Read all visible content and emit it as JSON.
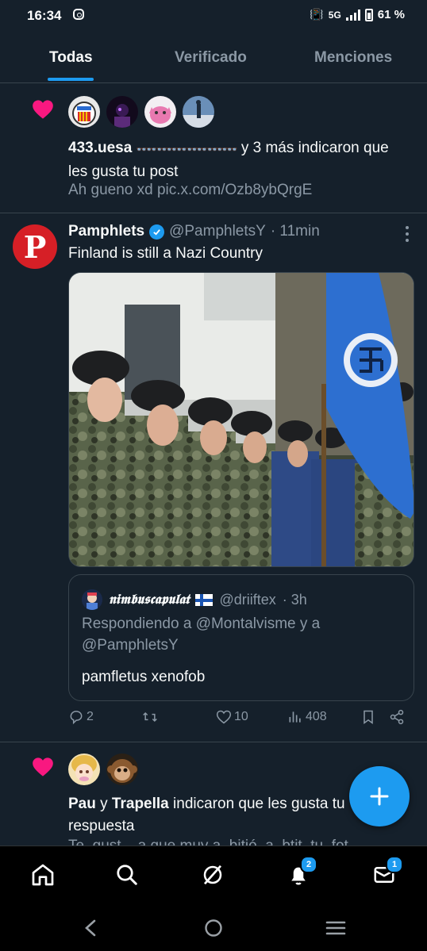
{
  "status_bar": {
    "time": "16:34",
    "network": "5G",
    "battery": "61 %"
  },
  "tabs": [
    {
      "label": "Todas",
      "active": true
    },
    {
      "label": "Verificado",
      "active": false
    },
    {
      "label": "Menciones",
      "active": false
    }
  ],
  "notification_1": {
    "user": "433.uesa",
    "emoji_suffix": "👓👓👓👓👓👓👓👓👓👓",
    "and_more": "y 3 más",
    "action": "indicaron que les gusta tu post",
    "preview": "Ah gueno xd pic.x.com/Ozb8ybQrgE"
  },
  "tweet": {
    "author_name": "Pamphlets",
    "author_handle": "@PamphletsY",
    "time": "· 11min",
    "avatar_letter": "P",
    "text": "Finland is still a Nazi Country",
    "quote": {
      "author_name": "𝖓𝖎𝖒𝖇𝖚𝖘𝖈𝖆𝖕𝖚𝖑𝖆𝖙",
      "author_handle": "@driiftex",
      "time": "· 3h",
      "reply_to": "Respondiendo a @Montalvisme y a @PamphletsY",
      "text": "pamfletus xenofob"
    },
    "actions": {
      "replies": "2",
      "reposts": "",
      "likes": "10",
      "views": "408"
    }
  },
  "notification_2": {
    "user1": "Pau",
    "conj": "y",
    "user2": "Trapella",
    "action": "indicaron que les gusta tu respuesta",
    "preview_cut": "Te_gust__a que muy a_bitió_a_btit_tu_fot_..."
  },
  "bottom_nav": {
    "notifications_badge": "2",
    "messages_badge": "1"
  },
  "colors": {
    "background": "#15202b",
    "accent": "#1d9bf0",
    "like": "#f91880",
    "muted": "#8b98a5"
  }
}
